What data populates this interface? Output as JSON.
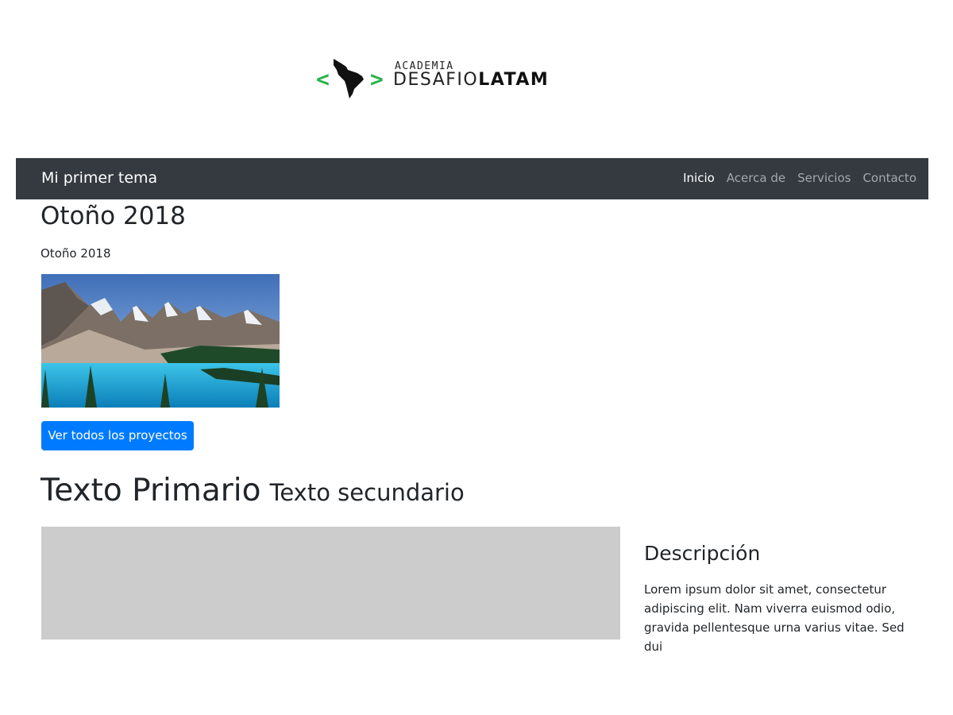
{
  "logo": {
    "left_bracket": "<",
    "right_bracket": ">",
    "line1": "ACADEMIA",
    "line2_part1": "DESAFIO",
    "line2_part2": "LATAM",
    "accent_color": "#27b24a"
  },
  "navbar": {
    "brand": "Mi primer tema",
    "links": [
      "Inicio",
      "Acerca de",
      "Servicios",
      "Contacto"
    ],
    "active_link": "Inicio",
    "background": "#343a40"
  },
  "season": {
    "title": "Otoño 2018",
    "subtitle": "Otoño 2018",
    "image_icon": "mountain-lake-photo"
  },
  "button": {
    "label": "Ver todos los proyectos",
    "color": "#007bff"
  },
  "heading": {
    "primary": "Texto Primario",
    "secondary": "Texto secundario"
  },
  "description": {
    "title": "Descripción",
    "text": "Lorem ipsum dolor sit amet, consectetur adipiscing elit. Nam viverra euismod odio, gravida pellentesque urna varius vitae. Sed dui"
  }
}
